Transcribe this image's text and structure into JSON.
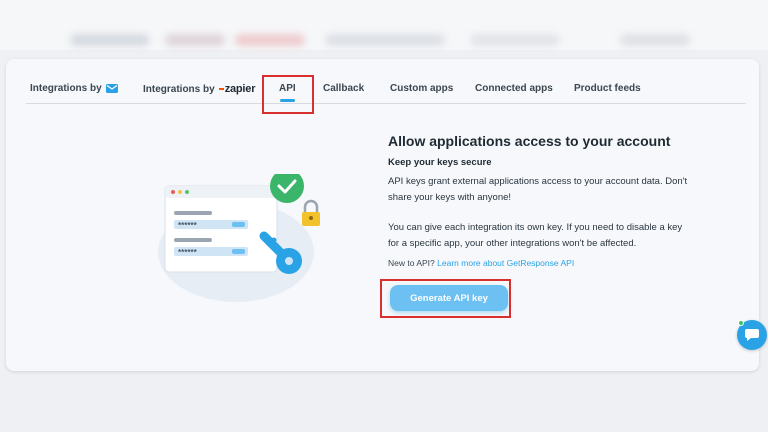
{
  "tabs": [
    {
      "label": "Integrations by",
      "icon": "envelope-icon"
    },
    {
      "label": "Integrations by",
      "brand": "zapier"
    },
    {
      "label": "API",
      "active": true
    },
    {
      "label": "Callback"
    },
    {
      "label": "Custom apps"
    },
    {
      "label": "Connected apps"
    },
    {
      "label": "Product feeds"
    }
  ],
  "main": {
    "title": "Allow applications access to your account",
    "subtitle": "Keep your keys secure",
    "para1": "API keys grant external applications access to your account data. Don't share your keys with anyone!",
    "para2": "You can give each integration its own key. If you need to disable a key for a specific app, your other integrations won't be affected.",
    "new_to": "New to API?",
    "learn_link": "Learn more about GetResponse API",
    "button": "Generate API key"
  },
  "illustration": {
    "masked1": "******",
    "masked2": "******"
  },
  "colors": {
    "accent": "#2aa3e6",
    "button": "#6cc1f2",
    "highlight": "#d9302f",
    "check": "#3ab56a",
    "lock": "#f2c22c",
    "zapier": "#ff4f00"
  }
}
